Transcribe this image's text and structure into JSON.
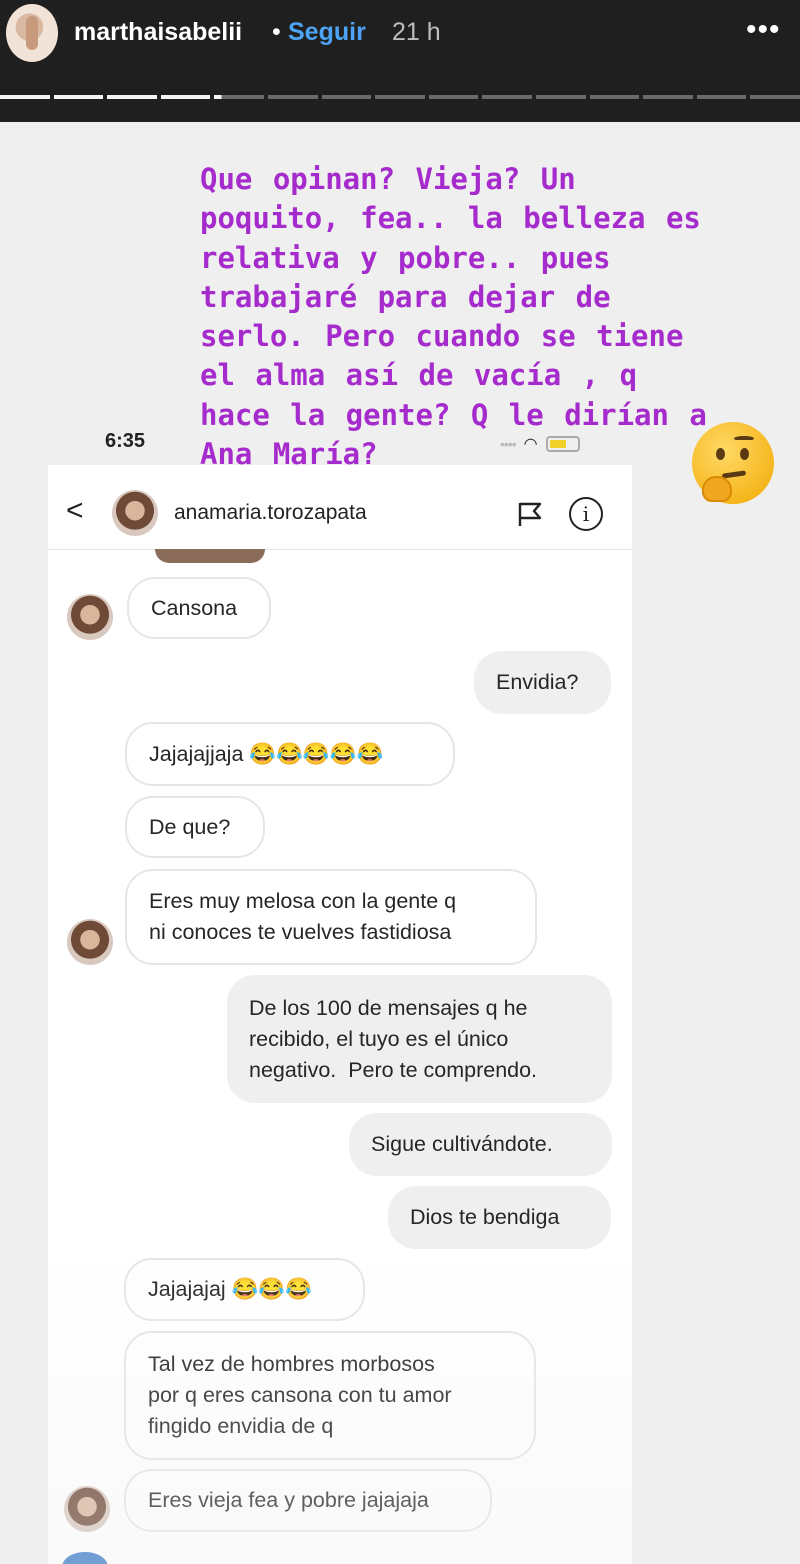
{
  "story": {
    "username": "marthaisabelii",
    "separator": "•",
    "follow_label": "Seguir",
    "time": "21 h",
    "more_label": "•••",
    "progress_segments": 15,
    "progress_done": 4
  },
  "caption": {
    "text": "Que opinan? Vieja? Un\npoquito, fea.. la belleza es\nrelativa y pobre.. pues\ntrabajaré para dejar de\nserlo. Pero cuando se tiene\nel alma así de vacía , q\nhace la gente? Q le dirían a\nAna María?",
    "emoji_icon": "thinking-face-icon"
  },
  "screenshot": {
    "status_time": "6:35",
    "signal": "••••",
    "wifi": "◠",
    "dm_username": "anamaria.torozapata",
    "back_label": "<",
    "info_label": "i"
  },
  "messages": [
    {
      "side": "received",
      "text": "Cansona"
    },
    {
      "side": "sent",
      "text": "Envidia?"
    },
    {
      "side": "received",
      "text": "Jajajajjaja 😂😂😂😂😂"
    },
    {
      "side": "received",
      "text": "De que?"
    },
    {
      "side": "received",
      "text": "Eres muy melosa con la gente q\nni conoces te vuelves fastidiosa"
    },
    {
      "side": "sent",
      "text": "De los 100 de mensajes q he\nrecibido, el tuyo es el único\nnegativo.  Pero te comprendo."
    },
    {
      "side": "sent",
      "text": "Sigue cultivándote."
    },
    {
      "side": "sent",
      "text": "Dios te bendiga"
    },
    {
      "side": "received",
      "text": "Jajajajaj 😂😂😂"
    },
    {
      "side": "received",
      "text": "Tal vez de hombres morbosos\npor q eres cansona con tu amor\nfingido envidia de q"
    },
    {
      "side": "received",
      "text": "Eres vieja fea y pobre jajajaja"
    }
  ]
}
